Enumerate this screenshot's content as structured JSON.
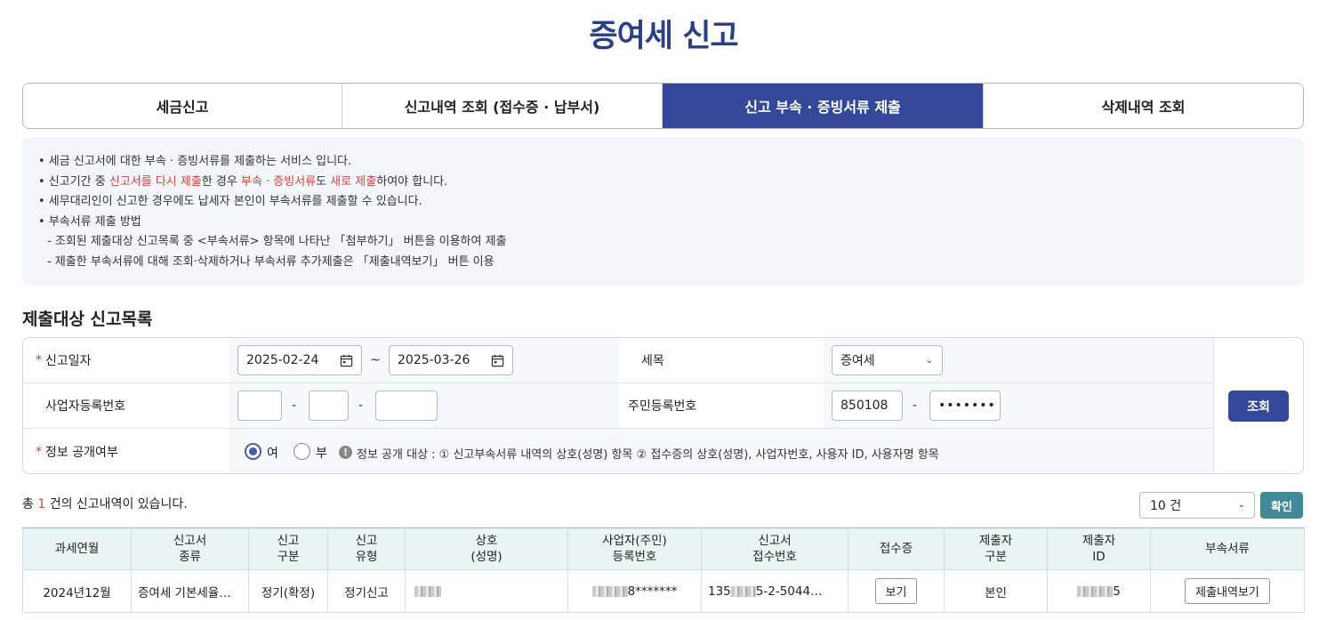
{
  "page": {
    "title": "증여세 신고"
  },
  "tabs": [
    {
      "label": "세금신고",
      "active": false
    },
    {
      "label": "신고내역 조회 (접수증 · 납부서)",
      "active": false
    },
    {
      "label": "신고 부속 · 증빙서류 제출",
      "active": true
    },
    {
      "label": "삭제내역 조회",
      "active": false
    }
  ],
  "info": {
    "line1": "• 세금 신고서에 대한 부속 · 증빙서류를 제출하는 서비스 입니다.",
    "line2": {
      "p1": "• 신고기간 중 ",
      "h1": "신고서를 다시 제출",
      "p2": "한 경우 ",
      "h2": "부속 · 증빙서류",
      "p3": "도 ",
      "h3": "새로 제출",
      "p4": "하여야 합니다."
    },
    "line3": "• 세무대리인이 신고한 경우에도 납세자 본인이 부속서류를 제출할 수 있습니다.",
    "line4": "• 부속서류 제출 방법",
    "line5": "- 조회된 제출대상 신고목록 중 <부속서류> 항목에 나타난 「첨부하기」 버튼을 이용하여 제출",
    "line6": "- 제출한 부속서류에 대해 조회·삭제하거나 부속서류 추가제출은 「제출내역보기」 버튼 이용"
  },
  "section_title": "제출대상 신고목록",
  "form": {
    "date_label": "신고일자",
    "date_from": "2025-02-24",
    "date_sep": "~",
    "date_to": "2025-03-26",
    "tax_label": "세목",
    "tax_value": "증여세",
    "biz_label": "사업자등록번호",
    "dash": "-",
    "rrn_label": "주민등록번호",
    "rrn_front": "850108",
    "rrn_back": "•••••••",
    "disclose_label": "정보 공개여부",
    "radio_yes": "여",
    "radio_no": "부",
    "disclose_selected": "여",
    "notice": "정보 공개 대상 : ① 신고부속서류 내역의 상호(성명) 항목 ② 접수증의 상호(성명), 사업자번호, 사용자 ID, 사용자명 항목",
    "search_button": "조회"
  },
  "result": {
    "count_prefix": "총 ",
    "count": "1",
    "count_suffix": " 건의 신고내역이 있습니다.",
    "page_size": "10 건",
    "confirm_button": "확인"
  },
  "table": {
    "headers": [
      "과세연월",
      "신고서\n종류",
      "신고\n구분",
      "신고\n유형",
      "상호\n(성명)",
      "사업자(주민)\n등록번호",
      "신고서\n접수번호",
      "접수증",
      "제출자\n구분",
      "제출자\nID",
      "부속서류"
    ],
    "rows": [
      {
        "period": "2024년12월",
        "form_type": "증여세 기본세율…",
        "report_div": "정기(확정)",
        "report_type": "정기신고",
        "name": "",
        "reg_no": "8*******",
        "receipt_no_a": "135",
        "receipt_no_b": "5-2-5044…",
        "receipt_btn": "보기",
        "submitter_div": "본인",
        "submitter_id": "5",
        "docs_btn": "제출내역보기"
      }
    ]
  }
}
